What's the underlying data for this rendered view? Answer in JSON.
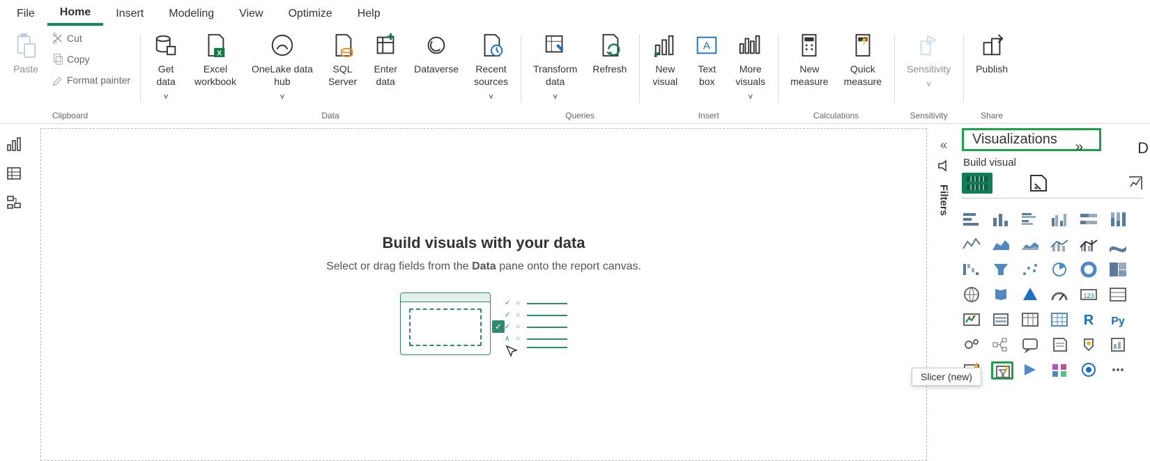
{
  "tabs": {
    "file": "File",
    "home": "Home",
    "insert": "Insert",
    "modeling": "Modeling",
    "view": "View",
    "optimize": "Optimize",
    "help": "Help"
  },
  "ribbon": {
    "clipboard": {
      "paste": "Paste",
      "cut": "Cut",
      "copy": "Copy",
      "format_painter": "Format painter",
      "group": "Clipboard"
    },
    "data": {
      "get_data": "Get\ndata",
      "excel": "Excel\nworkbook",
      "onelake": "OneLake data\nhub",
      "sql": "SQL\nServer",
      "enter": "Enter\ndata",
      "dataverse": "Dataverse",
      "recent": "Recent\nsources",
      "group": "Data"
    },
    "queries": {
      "transform": "Transform\ndata",
      "refresh": "Refresh",
      "group": "Queries"
    },
    "insert_grp": {
      "new_visual": "New\nvisual",
      "text_box": "Text\nbox",
      "more": "More\nvisuals",
      "group": "Insert"
    },
    "calc": {
      "new_measure": "New\nmeasure",
      "quick": "Quick\nmeasure",
      "group": "Calculations"
    },
    "sens": {
      "sensitivity": "Sensitivity",
      "group": "Sensitivity"
    },
    "share": {
      "publish": "Publish",
      "group": "Share"
    }
  },
  "canvas": {
    "title": "Build visuals with your data",
    "sub_pre": "Select or drag fields from the ",
    "sub_bold": "Data",
    "sub_post": " pane onto the report canvas."
  },
  "filters_label": "Filters",
  "viz": {
    "title": "Visualizations",
    "subtitle": "Build visual"
  },
  "tooltip": "Slicer (new)",
  "data_pane_letter": "D"
}
